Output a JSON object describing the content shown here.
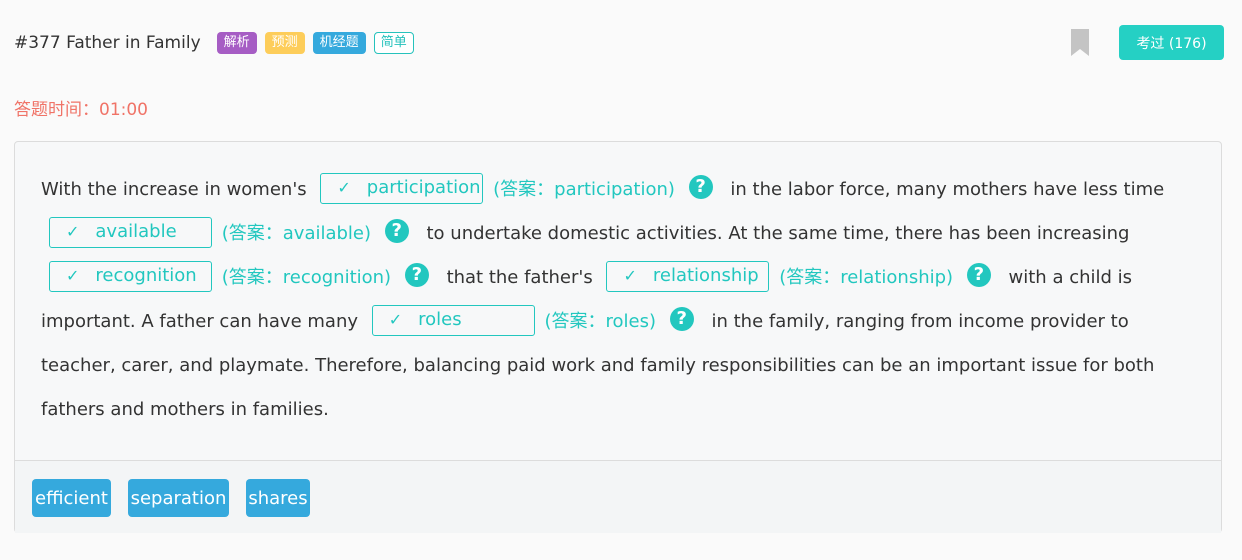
{
  "header": {
    "title": "#377 Father in Family",
    "tags": [
      "解析",
      "预测",
      "机经题",
      "简单"
    ],
    "exam_button": "考过 (176)"
  },
  "timer": "答题时间：01:00",
  "passage": {
    "segments": [
      "With the increase in women's",
      "in the labor force, many mothers have less time",
      "to undertake domestic activities. At the same time, there has been increasing",
      "that the father's",
      "with a child is important. A father can have many",
      "in the family, ranging from income provider to teacher, carer, and playmate. Therefore, balancing paid work and family responsibilities can be an important issue for both fathers and mothers in families."
    ],
    "blanks": [
      {
        "value": "participation",
        "answer": "(答案：participation)"
      },
      {
        "value": "available",
        "answer": "(答案：available)"
      },
      {
        "value": "recognition",
        "answer": "(答案：recognition)"
      },
      {
        "value": "relationship",
        "answer": "(答案：relationship)"
      },
      {
        "value": "roles",
        "answer": "(答案：roles)"
      }
    ],
    "check_glyph": "✓",
    "help_glyph": "?"
  },
  "options": [
    "efficient",
    "separation",
    "shares"
  ],
  "colors": {
    "accent": "#22c7bf",
    "timer": "#f07367",
    "tag_purple": "#a65dc4",
    "tag_yellow": "#fdcd5a",
    "tag_blue": "#35a9dd"
  }
}
